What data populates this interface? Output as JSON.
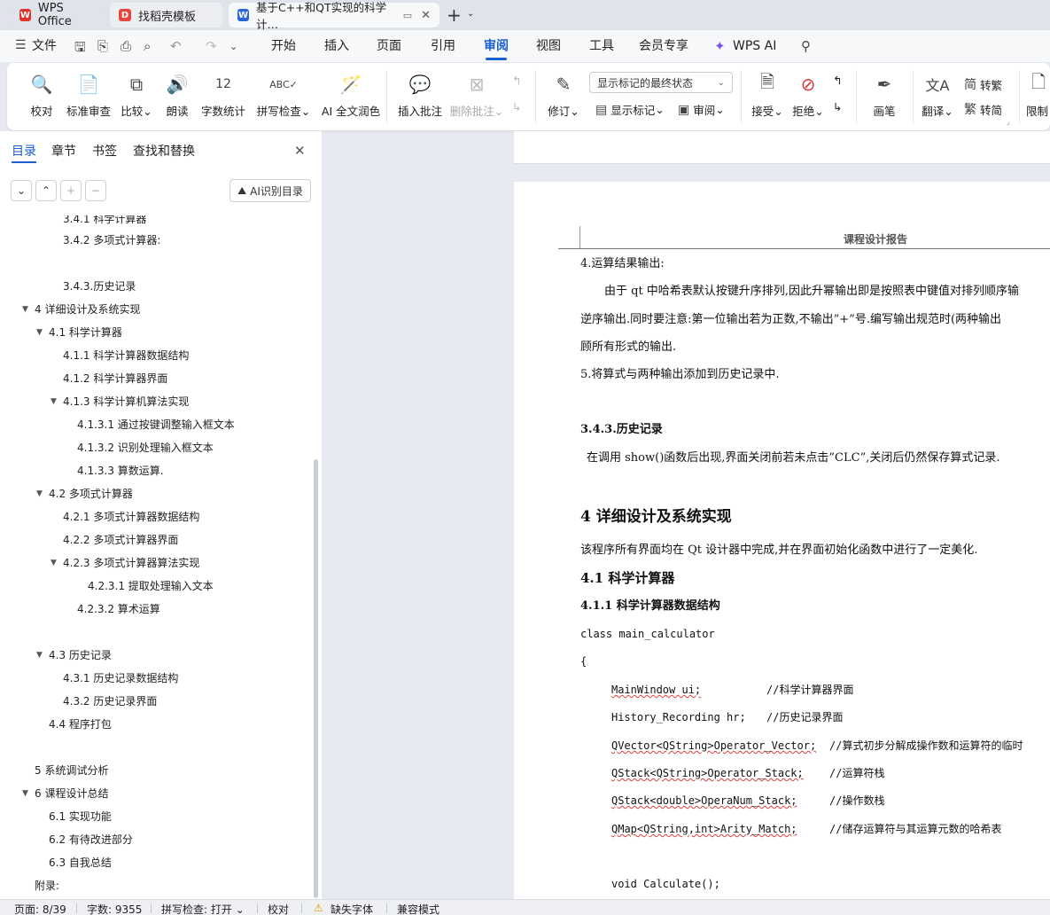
{
  "tabs": [
    {
      "label": "WPS Office",
      "icon": "wps-logo-icon"
    },
    {
      "label": "找稻壳模板",
      "icon": "docer-icon"
    },
    {
      "label": "基于C++和QT实现的科学计…",
      "icon": "word-doc-icon"
    }
  ],
  "menu": {
    "file": "文件",
    "items": [
      "开始",
      "插入",
      "页面",
      "引用",
      "审阅",
      "视图",
      "工具",
      "会员专享"
    ],
    "active": "审阅",
    "wps_ai": "WPS AI"
  },
  "ribbon": {
    "proofread": "校对",
    "standard_review": "标准审查",
    "compare": "比较",
    "read_aloud": "朗读",
    "word_count": "字数统计",
    "spell_check": "拼写检查",
    "ai_polish": "AI 全文润色",
    "insert_comment": "插入批注",
    "delete_comment": "删除批注",
    "track": "修订",
    "markup_state": "显示标记的最终状态",
    "show_markup": "显示标记",
    "review_pane": "审阅",
    "accept": "接受",
    "reject": "拒绝",
    "pen": "画笔",
    "translate": "翻译",
    "to_traditional": "转繁",
    "to_simplified": "转简",
    "restrict": "限制"
  },
  "sidebar": {
    "tabs": [
      "目录",
      "章节",
      "书签",
      "查找和替换"
    ],
    "ai_toc": "AI识别目录",
    "toc": [
      {
        "text": "3.4.1 科学计算器"
      },
      {
        "text": "3.4.2 多项式计算器:"
      },
      {
        "text": "3.4.3.历史记录"
      },
      {
        "text": "4 详细设计及系统实现"
      },
      {
        "text": "4.1 科学计算器"
      },
      {
        "text": "4.1.1 科学计算器数据结构"
      },
      {
        "text": "4.1.2 科学计算器界面"
      },
      {
        "text": "4.1.3 科学计算机算法实现"
      },
      {
        "text": "4.1.3.1 通过按键调整输入框文本"
      },
      {
        "text": "4.1.3.2 识别处理输入框文本"
      },
      {
        "text": "4.1.3.3 算数运算."
      },
      {
        "text": "4.2 多项式计算器"
      },
      {
        "text": "4.2.1 多项式计算器数据结构"
      },
      {
        "text": "4.2.2 多项式计算器界面"
      },
      {
        "text": "4.2.3 多项式计算器算法实现"
      },
      {
        "text": "4.2.3.1  提取处理输入文本"
      },
      {
        "text": "4.2.3.2 算术运算"
      },
      {
        "text": "4.3  历史记录"
      },
      {
        "text": "4.3.1 历史记录数据结构"
      },
      {
        "text": "4.3.2 历史记录界面"
      },
      {
        "text": "4.4 程序打包"
      },
      {
        "text": "5 系统调试分析"
      },
      {
        "text": "6 课程设计总结"
      },
      {
        "text": "6.1 实现功能"
      },
      {
        "text": "6.2 有待改进部分"
      },
      {
        "text": "6.3 自我总结"
      },
      {
        "text": "附录:"
      }
    ]
  },
  "document": {
    "header": "课程设计报告",
    "lines": [
      "4.运算结果输出:",
      "由于 qt 中哈希表默认按键升序排列,因此升幂输出即是按照表中键值对排列顺序输",
      "逆序输出.同时要注意:第一位输出若为正数,不输出”+”号.编写输出规范时(两种输出",
      "顾所有形式的输出.",
      "5.将算式与两种输出添加到历史记录中.",
      "3.4.3.历史记录",
      "在调用 show()函数后出现,界面关闭前若未点击”CLC”,关闭后仍然保存算式记录.",
      "4 详细设计及系统实现",
      "该程序所有界面均在 Qt 设计器中完成,并在界面初始化函数中进行了一定美化.",
      "4.1 科学计算器",
      "4.1.1 科学计算器数据结构",
      "class main_calculator",
      "{"
    ],
    "code": [
      {
        "decl": "MainWindow ui;",
        "comment": "//科学计算器界面"
      },
      {
        "decl": "History_Recording hr;",
        "comment": "//历史记录界面"
      },
      {
        "decl": "QVector<QString>Operator_Vector;",
        "comment": "//算式初步分解成操作数和运算符的临时"
      },
      {
        "decl": "QStack<QString>Operator_Stack;",
        "comment": "//运算符栈"
      },
      {
        "decl": "QStack<double>OperaNum_Stack;",
        "comment": "//操作数栈"
      },
      {
        "decl": "QMap<QString,int>Arity_Match;",
        "comment": "//储存运算符与其运算元数的哈希表"
      }
    ],
    "last_line": "void Calculate();"
  },
  "status": {
    "page": "页面: 8/39",
    "words": "字数: 9355",
    "spell": "拼写检查: 打开",
    "proof": "校对",
    "missing_font": "缺失字体",
    "compat": "兼容模式"
  }
}
